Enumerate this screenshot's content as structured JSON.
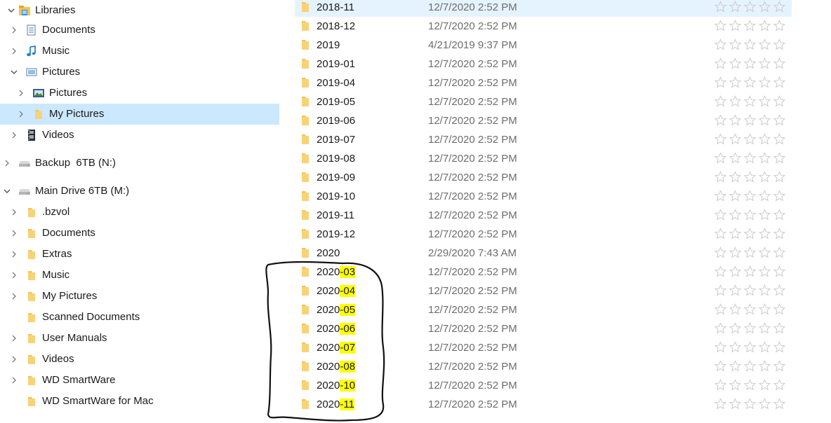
{
  "nav": {
    "items": [
      {
        "label": "Libraries",
        "icon": "libraries-icon",
        "chevron": "down",
        "selected": false
      },
      {
        "label": "Documents",
        "icon": "documents-library-icon",
        "chevron": "right",
        "selected": false
      },
      {
        "label": "Music",
        "icon": "music-icon",
        "chevron": "right",
        "selected": false
      },
      {
        "label": "Pictures",
        "icon": "pictures-library-icon",
        "chevron": "down",
        "selected": false
      },
      {
        "label": "Pictures",
        "icon": "pictures-folder-icon",
        "chevron": "right",
        "selected": false
      },
      {
        "label": "My Pictures",
        "icon": "folder-icon",
        "chevron": "right",
        "selected": true
      },
      {
        "label": "Videos",
        "icon": "videos-icon",
        "chevron": "right",
        "selected": false
      },
      {
        "label": "Backup  6TB (N:)",
        "icon": "drive-icon",
        "chevron": "right",
        "selected": false
      },
      {
        "label": "Main Drive 6TB (M:)",
        "icon": "drive-icon",
        "chevron": "down",
        "selected": false
      },
      {
        "label": ".bzvol",
        "icon": "folder-icon",
        "chevron": "right",
        "selected": false
      },
      {
        "label": "Documents",
        "icon": "folder-icon",
        "chevron": "right",
        "selected": false
      },
      {
        "label": "Extras",
        "icon": "folder-icon",
        "chevron": "right",
        "selected": false
      },
      {
        "label": "Music",
        "icon": "folder-icon",
        "chevron": "right",
        "selected": false
      },
      {
        "label": "My Pictures",
        "icon": "folder-icon",
        "chevron": "right",
        "selected": false
      },
      {
        "label": "Scanned Documents",
        "icon": "folder-icon",
        "chevron": "none",
        "selected": false
      },
      {
        "label": "User Manuals",
        "icon": "folder-icon",
        "chevron": "right",
        "selected": false
      },
      {
        "label": "Videos",
        "icon": "folder-icon",
        "chevron": "right",
        "selected": false
      },
      {
        "label": "WD SmartWare",
        "icon": "folder-icon",
        "chevron": "right",
        "selected": false
      },
      {
        "label": "WD SmartWare for Mac",
        "icon": "folder-icon",
        "chevron": "none",
        "selected": false
      }
    ]
  },
  "files": [
    {
      "name": "2018-11",
      "date": "12/7/2020 2:52 PM",
      "hover": true
    },
    {
      "name": "2018-12",
      "date": "12/7/2020 2:52 PM"
    },
    {
      "name": "2019",
      "date": "4/21/2019 9:37 PM"
    },
    {
      "name": "2019-01",
      "date": "12/7/2020 2:52 PM"
    },
    {
      "name": "2019-04",
      "date": "12/7/2020 2:52 PM"
    },
    {
      "name": "2019-05",
      "date": "12/7/2020 2:52 PM"
    },
    {
      "name": "2019-06",
      "date": "12/7/2020 2:52 PM"
    },
    {
      "name": "2019-07",
      "date": "12/7/2020 2:52 PM"
    },
    {
      "name": "2019-08",
      "date": "12/7/2020 2:52 PM"
    },
    {
      "name": "2019-09",
      "date": "12/7/2020 2:52 PM"
    },
    {
      "name": "2019-10",
      "date": "12/7/2020 2:52 PM"
    },
    {
      "name": "2019-11",
      "date": "12/7/2020 2:52 PM"
    },
    {
      "name": "2019-12",
      "date": "12/7/2020 2:52 PM"
    },
    {
      "name": "2020",
      "date": "2/29/2020 7:43 AM"
    },
    {
      "name": "2020-03",
      "date": "12/7/2020 2:52 PM",
      "highlight": true
    },
    {
      "name": "2020-04",
      "date": "12/7/2020 2:52 PM",
      "highlight": true
    },
    {
      "name": "2020-05",
      "date": "12/7/2020 2:52 PM",
      "highlight": true
    },
    {
      "name": "2020-06",
      "date": "12/7/2020 2:52 PM",
      "highlight": true
    },
    {
      "name": "2020-07",
      "date": "12/7/2020 2:52 PM",
      "highlight": true
    },
    {
      "name": "2020-08",
      "date": "12/7/2020 2:52 PM",
      "highlight": true
    },
    {
      "name": "2020-10",
      "date": "12/7/2020 2:52 PM",
      "highlight": true
    },
    {
      "name": "2020-11",
      "date": "12/7/2020 2:52 PM",
      "highlight": true
    }
  ],
  "rating": {
    "max": 5,
    "value": 0
  },
  "colors": {
    "selected": "#cce8ff",
    "hover": "#e5f3ff",
    "folder": "#f4c44e",
    "highlight": "#ffff00",
    "date_text": "#6d6d6d",
    "star": "#c8c8c8"
  }
}
